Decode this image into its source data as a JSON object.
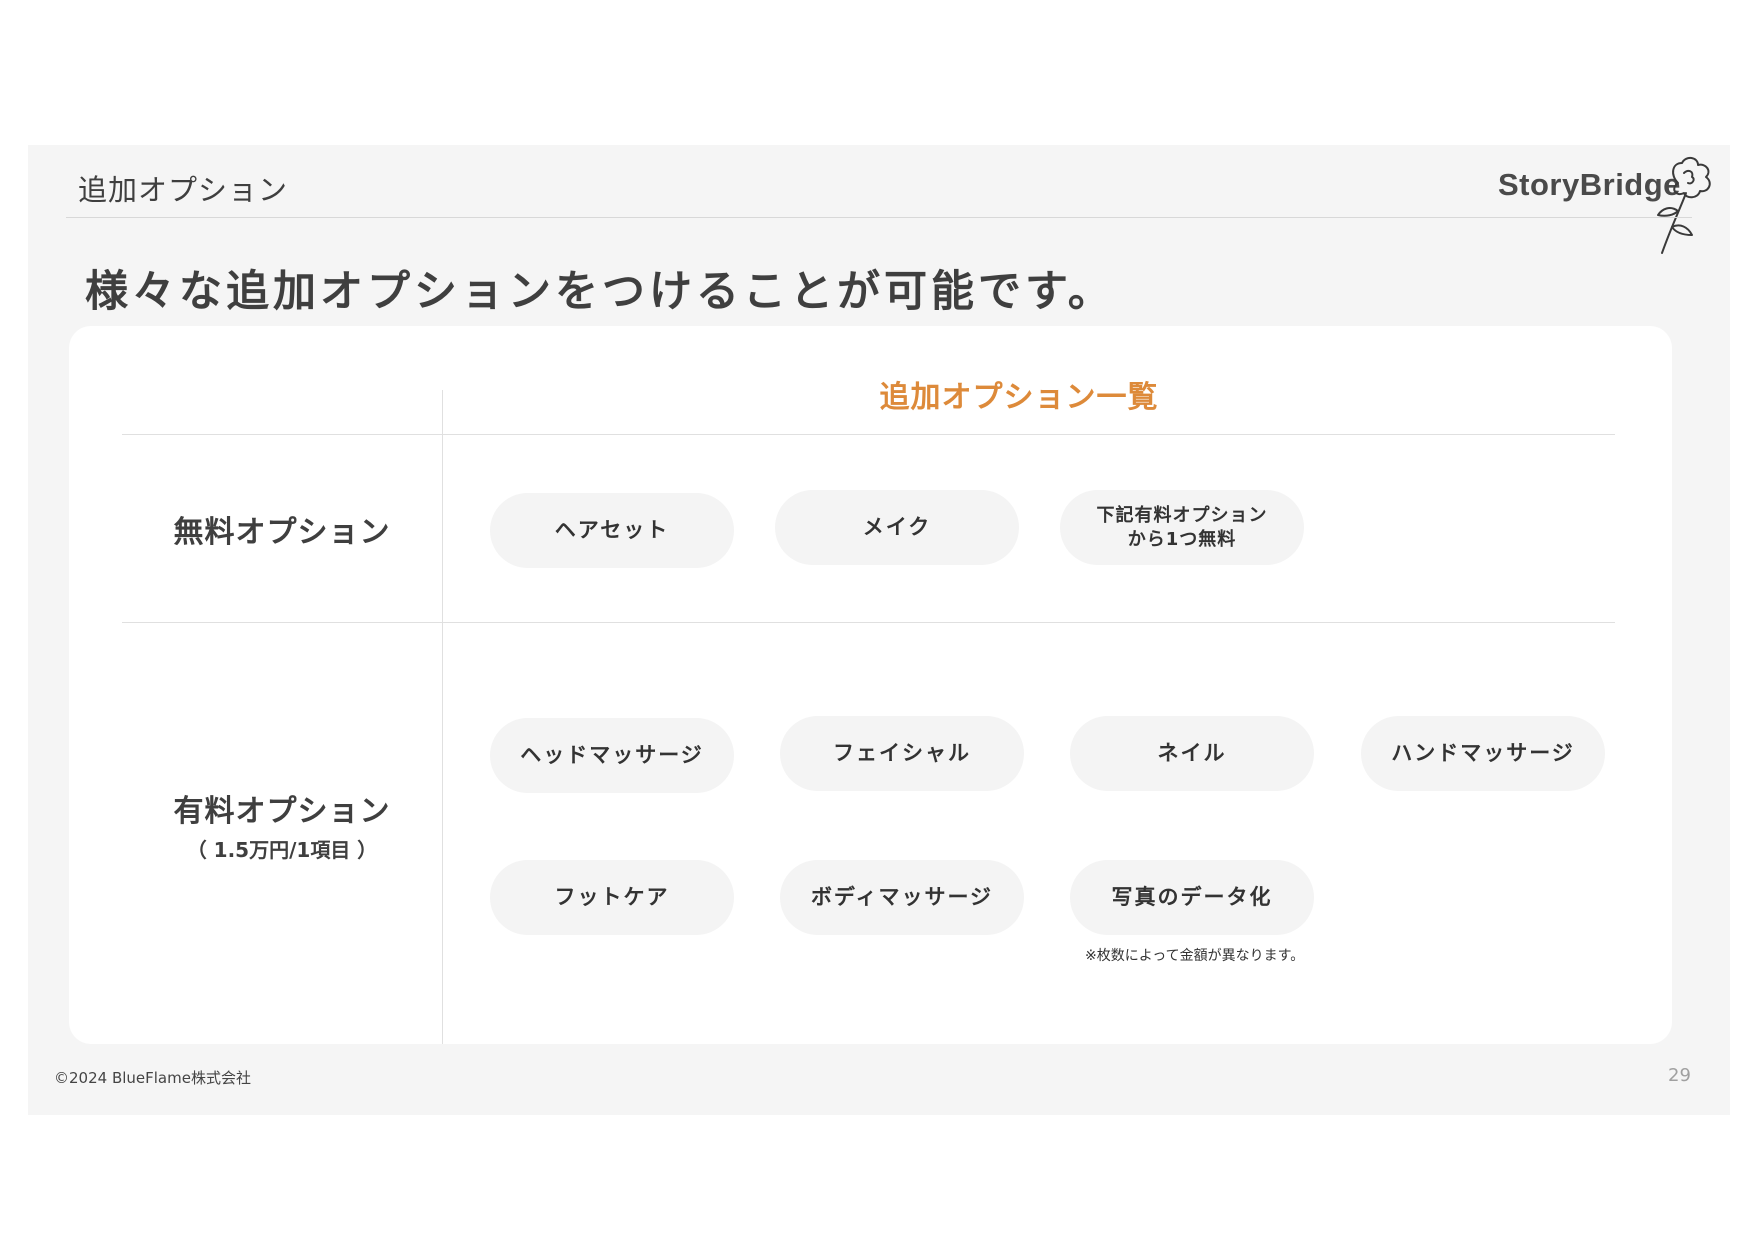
{
  "header": {
    "section_title": "追加オプション",
    "brand": "StoryBridge",
    "logo_icon": "carnation-flower-icon"
  },
  "main_heading": "様々な追加オプションをつけることが可能です。",
  "table": {
    "title": "追加オプション一覧",
    "free": {
      "label": "無料オプション",
      "items": [
        "ヘアセット",
        "メイク",
        "下記有料オプション\nから1つ無料"
      ]
    },
    "paid": {
      "label": "有料オプション",
      "sublabel": "（ 1.5万円/1項目 ）",
      "items": [
        "ヘッドマッサージ",
        "フェイシャル",
        "ネイル",
        "ハンドマッサージ",
        "フットケア",
        "ボディマッサージ",
        "写真のデータ化"
      ],
      "note": "※枚数によって金額が異なります。"
    }
  },
  "footer": {
    "copyright": "©2024 BlueFlame株式会社",
    "page_number": "29"
  },
  "colors": {
    "accent": "#dd8a3a",
    "background": "#f5f5f5",
    "card": "#ffffff",
    "pill": "#f4f4f4",
    "text": "#3f3f3f"
  }
}
